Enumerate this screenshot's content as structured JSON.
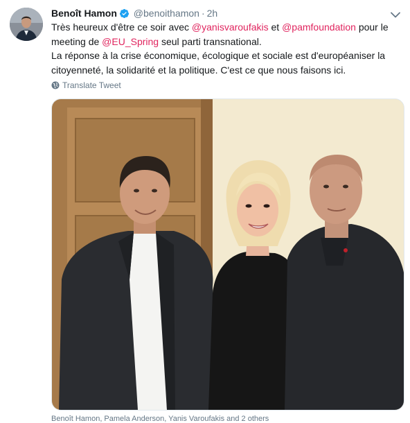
{
  "tweet": {
    "author_name": "Benoît Hamon",
    "handle": "@benoithamon",
    "separator": "·",
    "time": "2h",
    "text": {
      "line1_a": "Très heureux d'être ce soir avec ",
      "mention1": "@yanisvaroufakis",
      "line1_b": " et ",
      "mention2": "@pamfoundation",
      "line1_c": " pour le meeting de ",
      "mention3": "@EU_Spring",
      "line1_d": " seul parti transnational.",
      "paragraph2": "La réponse à la crise économique, écologique et sociale est d'européaniser la citoyenneté, la solidarité et la politique. C'est ce que nous faisons ici."
    },
    "translate_label": "Translate Tweet",
    "photo_tags": "Benoît Hamon, Pamela Anderson, Yanis Varoufakis and 2 others",
    "colors": {
      "link": "#e0245e",
      "verified": "#1da1f2",
      "secondary_text": "#657786"
    },
    "icons": {
      "verified": "verified-badge-icon",
      "caret": "chevron-down-icon",
      "translate": "globe-icon"
    }
  }
}
